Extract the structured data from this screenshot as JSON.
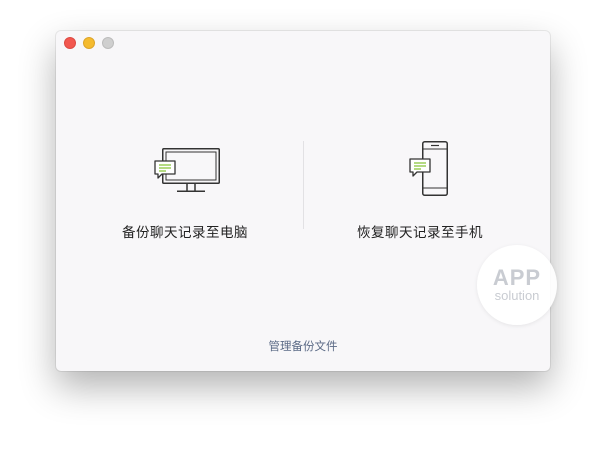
{
  "window": {
    "controls": {
      "close": "close",
      "minimize": "minimize",
      "zoom": "zoom"
    }
  },
  "options": {
    "backup_to_computer": {
      "label": "备份聊天记录至电脑",
      "icon": "monitor-chat-icon"
    },
    "restore_to_phone": {
      "label": "恢复聊天记录至手机",
      "icon": "phone-chat-icon"
    }
  },
  "footer": {
    "manage_backups": "管理备份文件"
  },
  "watermark": {
    "line1": "APP",
    "line2": "solution"
  },
  "colors": {
    "accent_green": "#8cc63f",
    "link": "#5b6a86",
    "close": "#f2574f",
    "minimize": "#f5bb2f",
    "zoom": "#cfcfcf"
  }
}
